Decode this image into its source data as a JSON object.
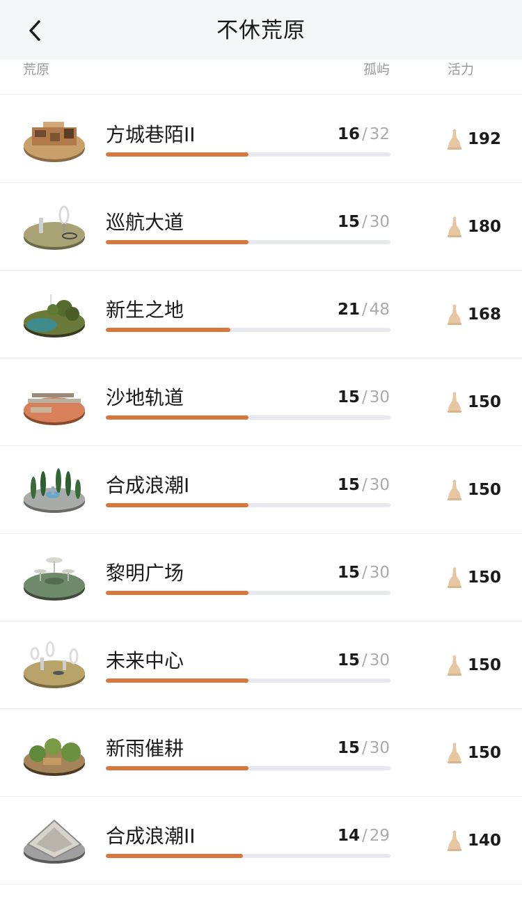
{
  "header": {
    "title": "不休荒原",
    "back_icon": "chevron-left-icon"
  },
  "columns": {
    "name": "荒原",
    "island": "孤屿",
    "vitality": "活力"
  },
  "colors": {
    "accent": "#d8763e",
    "track": "#e8e9ec",
    "bell": "#e6c7a1"
  },
  "rows": [
    {
      "name": "方城巷陌II",
      "done": "16",
      "total": "32",
      "progress": 0.5,
      "vitality": "192",
      "thumb": "city-block"
    },
    {
      "name": "巡航大道",
      "done": "15",
      "total": "30",
      "progress": 0.5,
      "vitality": "180",
      "thumb": "rings"
    },
    {
      "name": "新生之地",
      "done": "21",
      "total": "48",
      "progress": 0.4375,
      "vitality": "168",
      "thumb": "forest-lake"
    },
    {
      "name": "沙地轨道",
      "done": "15",
      "total": "30",
      "progress": 0.5,
      "vitality": "150",
      "thumb": "sand-track"
    },
    {
      "name": "合成浪潮I",
      "done": "15",
      "total": "30",
      "progress": 0.5,
      "vitality": "150",
      "thumb": "cypress-fountain"
    },
    {
      "name": "黎明广场",
      "done": "15",
      "total": "30",
      "progress": 0.5,
      "vitality": "150",
      "thumb": "mushroom-plaza"
    },
    {
      "name": "未来中心",
      "done": "15",
      "total": "30",
      "progress": 0.5,
      "vitality": "150",
      "thumb": "mirror-sculptures"
    },
    {
      "name": "新雨催耕",
      "done": "15",
      "total": "30",
      "progress": 0.5,
      "vitality": "150",
      "thumb": "farmland"
    },
    {
      "name": "合成浪潮II",
      "done": "14",
      "total": "29",
      "progress": 0.4828,
      "vitality": "140",
      "thumb": "pyramid"
    }
  ]
}
